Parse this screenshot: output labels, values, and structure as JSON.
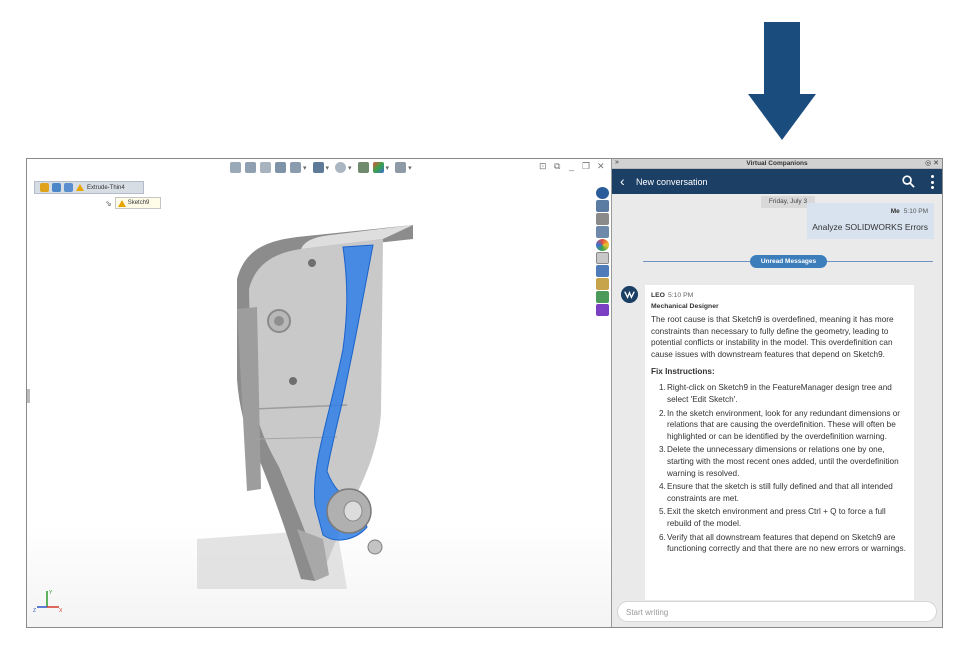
{
  "app": {
    "panel_title": "Virtual Companions",
    "panel_collapse_glyph": "»",
    "panel_controls_glyph": "◎ ✕"
  },
  "viewport": {
    "tree": {
      "feature_label": "Extrude-Thin4",
      "sketch_label": "Sketch9"
    },
    "window_controls": [
      "⊡",
      "⧉",
      "_",
      "❐",
      "✕"
    ],
    "triad": {
      "x": "X",
      "y": "Y",
      "z": "Z"
    }
  },
  "chat": {
    "header_title": "New conversation",
    "back_glyph": "‹",
    "date_label": "Friday, July 3",
    "user_message": {
      "sender": "Me",
      "time": "5:10 PM",
      "text": "Analyze SOLIDWORKS Errors"
    },
    "unread_label": "Unread Messages",
    "bot_message": {
      "sender": "LEO",
      "time": "5:10 PM",
      "role": "Mechanical Designer",
      "intro": "The root cause is that Sketch9 is overdefined, meaning it has more constraints than necessary to fully define the geometry, leading to potential conflicts or instability in the model. This overdefinition can cause issues with downstream features that depend on Sketch9.",
      "fix_title": "Fix Instructions:",
      "steps": [
        "Right-click on Sketch9 in the FeatureManager design tree and select 'Edit Sketch'.",
        "In the sketch environment, look for any redundant dimensions or relations that are causing the overdefinition. These will often be highlighted or can be identified by the overdefinition warning.",
        "Delete the unnecessary dimensions or relations one by one, starting with the most recent ones added, until the overdefinition warning is resolved.",
        "Ensure that the sketch is still fully defined and that all intended constraints are met.",
        "Exit the sketch environment and press Ctrl + Q to force a full rebuild of the model.",
        "Verify that all downstream features that depend on Sketch9 are functioning correctly and that there are no new errors or warnings."
      ]
    },
    "composer_placeholder": "Start writing"
  },
  "colors": {
    "arrow": "#1b4c7e",
    "header": "#1c3f66",
    "selection_blue": "#2f7fe8",
    "unread_pill": "#3c7dbb"
  }
}
